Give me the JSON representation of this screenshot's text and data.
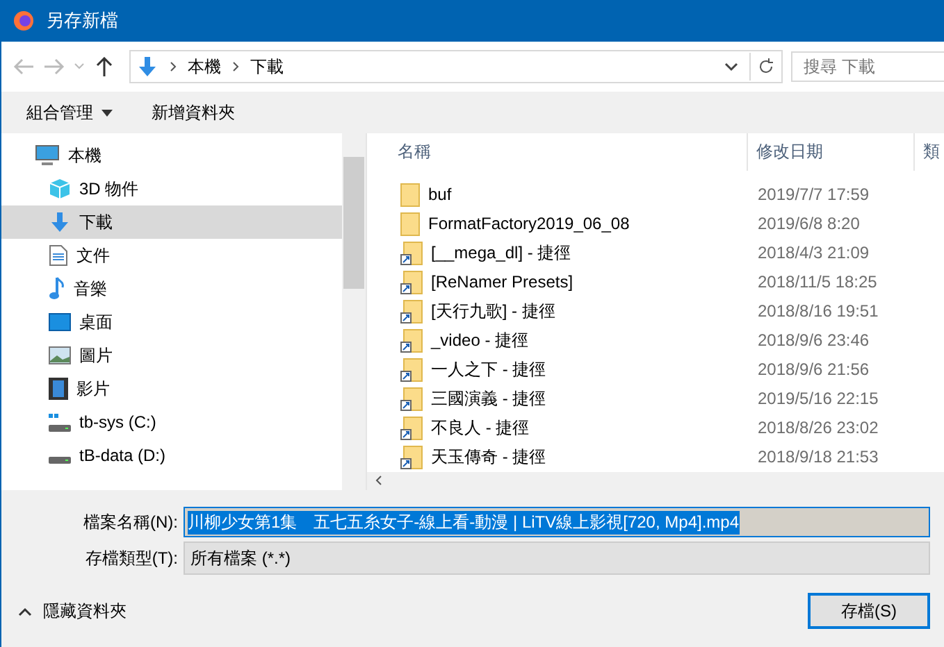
{
  "window": {
    "title": "另存新檔"
  },
  "nav": {
    "breadcrumbs": [
      "本機",
      "下載"
    ],
    "search": {
      "placeholder": "搜尋 下載"
    }
  },
  "toolbar": {
    "organize": "組合管理",
    "new_folder": "新增資料夾"
  },
  "sidebar": {
    "items": [
      {
        "label": "本機",
        "kind": "pc",
        "selected": false,
        "children": [
          {
            "label": "3D 物件",
            "kind": "cube",
            "selected": false
          },
          {
            "label": "下載",
            "kind": "download",
            "selected": true
          },
          {
            "label": "文件",
            "kind": "document",
            "selected": false
          },
          {
            "label": "音樂",
            "kind": "music",
            "selected": false
          },
          {
            "label": "桌面",
            "kind": "desktop",
            "selected": false
          },
          {
            "label": "圖片",
            "kind": "picture",
            "selected": false
          },
          {
            "label": "影片",
            "kind": "video",
            "selected": false
          },
          {
            "label": "tb-sys (C:)",
            "kind": "system-drive",
            "selected": false
          },
          {
            "label": "tB-data (D:)",
            "kind": "drive",
            "selected": false
          }
        ]
      }
    ]
  },
  "table": {
    "columns": [
      "名稱",
      "修改日期",
      "類"
    ],
    "rows": [
      {
        "name": "buf",
        "kind": "folder",
        "date": "2019/7/7 17:59"
      },
      {
        "name": "FormatFactory2019_06_08",
        "kind": "folder",
        "date": "2019/6/8 8:20"
      },
      {
        "name": "[__mega_dl] - 捷徑",
        "kind": "shortcut",
        "date": "2018/4/3 21:09"
      },
      {
        "name": "[ReNamer Presets]",
        "kind": "shortcut",
        "date": "2018/11/5 18:25"
      },
      {
        "name": "[天行九歌] - 捷徑",
        "kind": "shortcut",
        "date": "2018/8/16 19:51"
      },
      {
        "name": "_video - 捷徑",
        "kind": "shortcut",
        "date": "2018/9/6 23:46"
      },
      {
        "name": "一人之下 - 捷徑",
        "kind": "shortcut",
        "date": "2018/9/6 21:56"
      },
      {
        "name": "三國演義 - 捷徑",
        "kind": "shortcut",
        "date": "2019/5/16 22:15"
      },
      {
        "name": "不良人 - 捷徑",
        "kind": "shortcut",
        "date": "2018/8/26 23:02"
      },
      {
        "name": "天玉傳奇 - 捷徑",
        "kind": "shortcut",
        "date": "2018/9/18 21:53"
      }
    ]
  },
  "form": {
    "filename_label": "檔案名稱(N):",
    "filename": "川柳少女第1集　五七五糸女子-線上看-動漫 | LiTV線上影視[720, Mp4].mp4",
    "type_label": "存檔類型(T):",
    "type": "所有檔案 (*.*)"
  },
  "footer": {
    "hide_folders": "隱藏資料夾",
    "save": "存檔(S)"
  }
}
